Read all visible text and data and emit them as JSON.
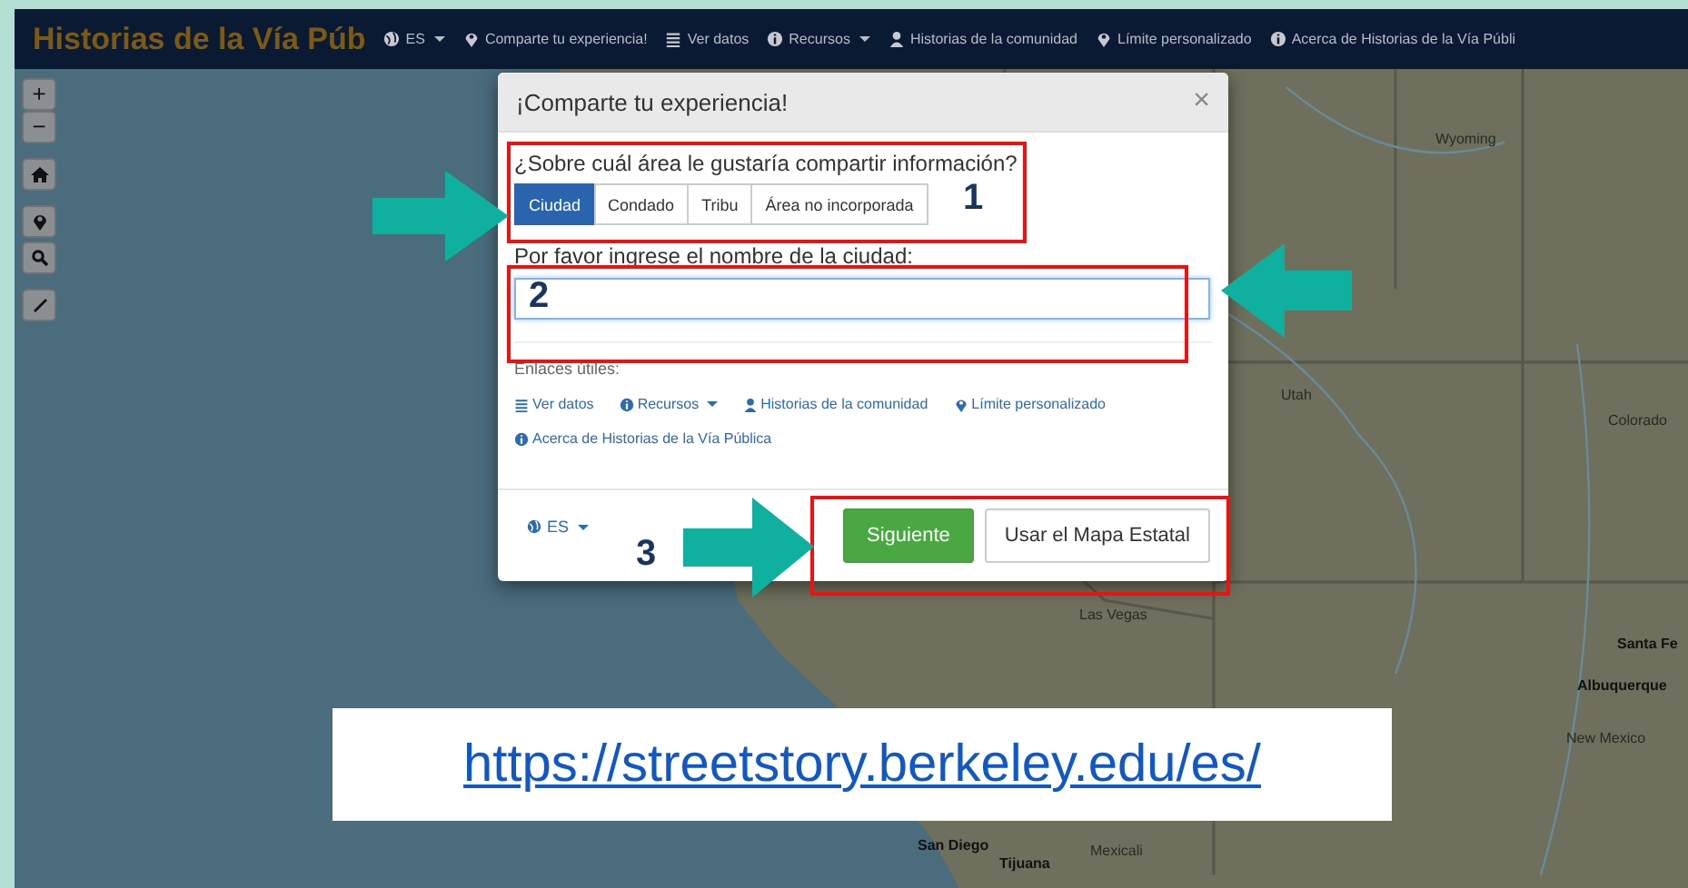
{
  "navbar": {
    "brand": "Historias de la Vía Púb",
    "items": [
      {
        "label": "ES",
        "dropdown": true
      },
      {
        "label": "Comparte tu experiencia!",
        "dropdown": false
      },
      {
        "label": "Ver datos",
        "dropdown": false
      },
      {
        "label": "Recursos",
        "dropdown": true
      },
      {
        "label": "Historias de la comunidad",
        "dropdown": false
      },
      {
        "label": "Límite personalizado",
        "dropdown": false
      },
      {
        "label": "Acerca de Historias de la Vía Públi",
        "dropdown": false
      }
    ]
  },
  "map_controls": {
    "zoom_in": "+",
    "zoom_out": "−"
  },
  "map_labels": [
    "Wyoming",
    "Utah",
    "Colorado",
    "Santa Fe",
    "Albuquerque",
    "New Mexico",
    "Las Vegas",
    "San Diego",
    "Tijuana",
    "Mexicali"
  ],
  "modal": {
    "title": "¡Comparte tu experiencia!",
    "close": "×",
    "question": "¿Sobre cuál área le gustaría compartir información?",
    "area_options": [
      {
        "label": "Ciudad",
        "selected": true
      },
      {
        "label": "Condado",
        "selected": false
      },
      {
        "label": "Tribu",
        "selected": false
      },
      {
        "label": "Área no incorporada",
        "selected": false
      }
    ],
    "input_label": "Por favor ingrese el nombre de la ciudad:",
    "links_heading": "Enlaces útiles:",
    "links": [
      {
        "label": "Ver datos",
        "dropdown": false
      },
      {
        "label": "Recursos",
        "dropdown": true
      },
      {
        "label": "Historias de la comunidad",
        "dropdown": false
      },
      {
        "label": "Límite personalizado",
        "dropdown": false
      },
      {
        "label": "Acerca de Historias de la Vía Pública",
        "dropdown": false
      }
    ],
    "language": "ES",
    "buttons": [
      {
        "label": "Siguiente",
        "primary": true
      },
      {
        "label": "Usar el Mapa Estatal",
        "primary": false
      }
    ]
  },
  "annotations": {
    "numbers": [
      "1",
      "2",
      "3"
    ],
    "url": "https://streetstory.berkeley.edu/es/"
  }
}
